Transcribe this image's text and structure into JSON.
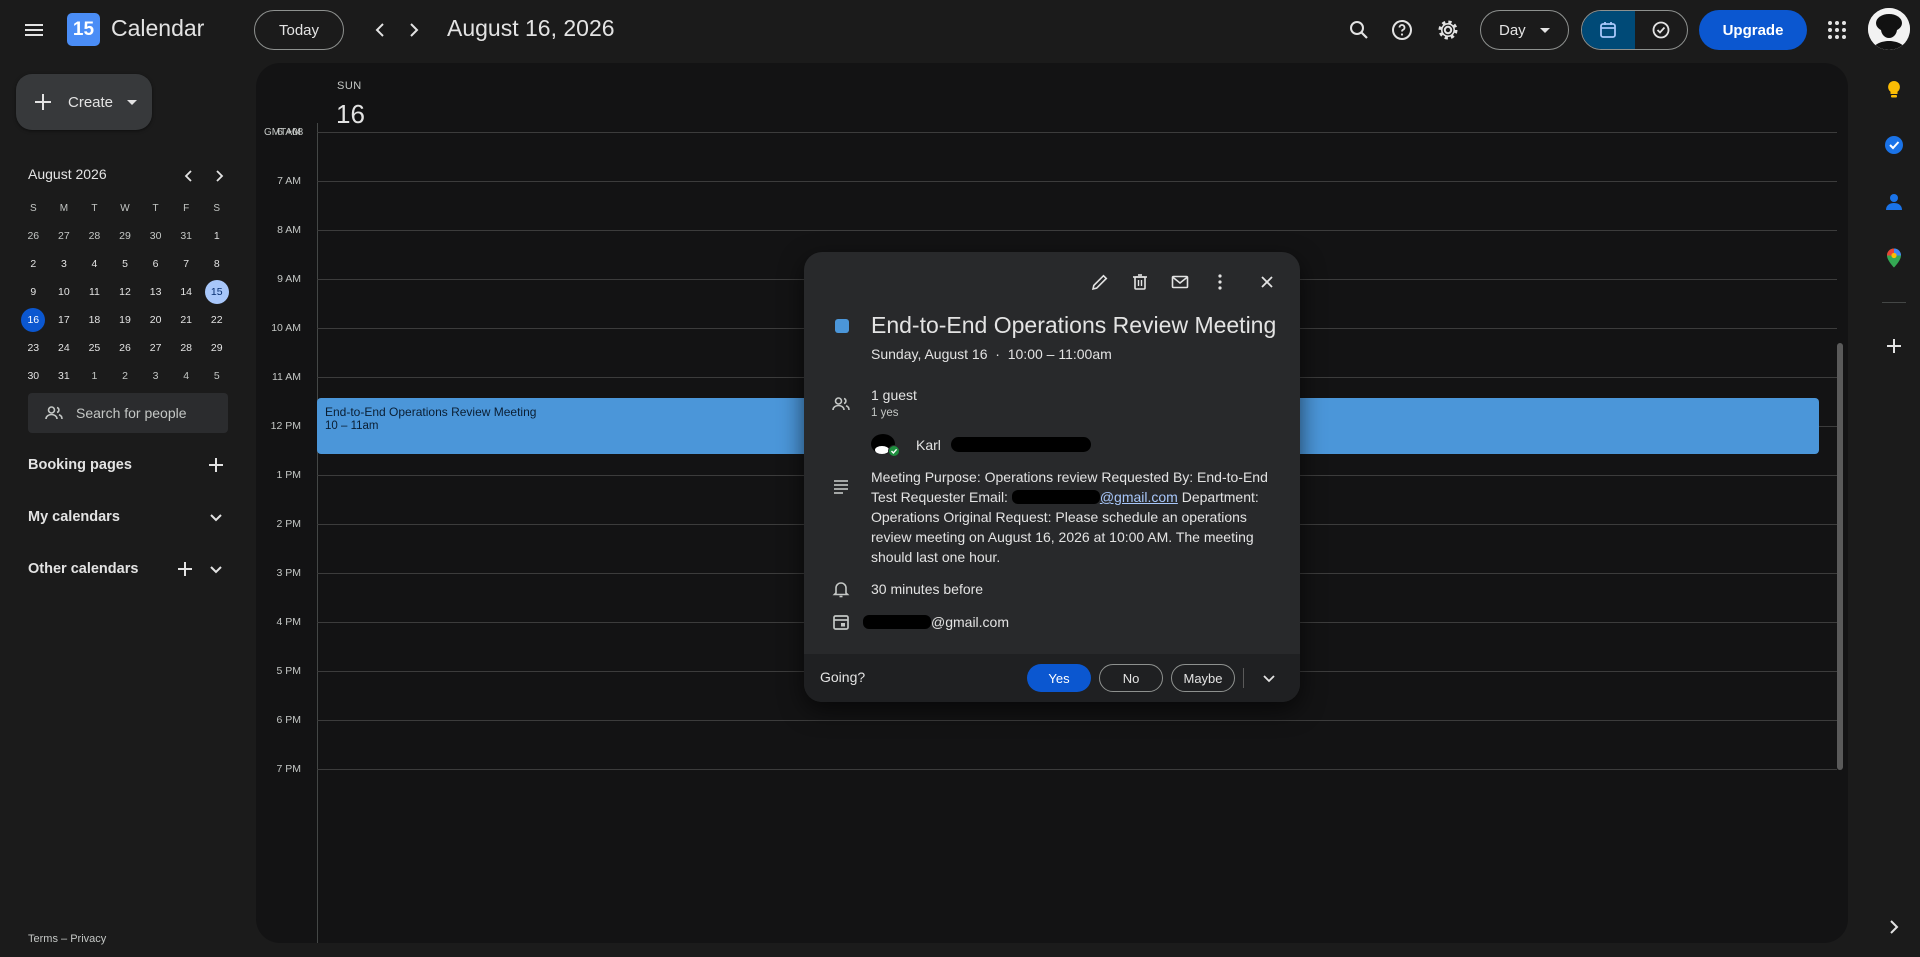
{
  "header": {
    "app_name": "Calendar",
    "logo_number": "15",
    "today_label": "Today",
    "date_title": "August 16, 2026",
    "view_label": "Day",
    "upgrade_label": "Upgrade"
  },
  "sidebar": {
    "create_label": "Create",
    "mini_calendar": {
      "title": "August 2026",
      "weekdays": [
        "S",
        "M",
        "T",
        "W",
        "T",
        "F",
        "S"
      ],
      "weeks": [
        [
          "26",
          "27",
          "28",
          "29",
          "30",
          "31",
          "1"
        ],
        [
          "2",
          "3",
          "4",
          "5",
          "6",
          "7",
          "8"
        ],
        [
          "9",
          "10",
          "11",
          "12",
          "13",
          "14",
          "15"
        ],
        [
          "16",
          "17",
          "18",
          "19",
          "20",
          "21",
          "22"
        ],
        [
          "23",
          "24",
          "25",
          "26",
          "27",
          "28",
          "29"
        ],
        [
          "30",
          "31",
          "1",
          "2",
          "3",
          "4",
          "5"
        ]
      ]
    },
    "search_people_placeholder": "Search for people",
    "booking_pages_label": "Booking pages",
    "my_calendars_label": "My calendars",
    "other_calendars_label": "Other calendars",
    "terms_label": "Terms",
    "footer_sep": "–",
    "privacy_label": "Privacy"
  },
  "day_view": {
    "day_name": "SUN",
    "day_number": "16",
    "timezone": "GMT+08",
    "hours": [
      "6 AM",
      "7 AM",
      "8 AM",
      "9 AM",
      "10 AM",
      "11 AM",
      "12 PM",
      "1 PM",
      "2 PM",
      "3 PM",
      "4 PM",
      "5 PM",
      "6 PM",
      "7 PM"
    ]
  },
  "event": {
    "title": "End-to-End Operations Review Meeting",
    "time": "10 – 11am",
    "color": "#4b96d9"
  },
  "popover": {
    "title": "End-to-End Operations Review Meeting",
    "date": "Sunday, August 16",
    "dot": "·",
    "time_range": "10:00 – 11:00am",
    "guests_count": "1 guest",
    "guests_summary": "1 yes",
    "guest_name": "Karl",
    "description_part1": "Meeting Purpose: Operations review  Requested By: End-to-End Test  Requester Email: ",
    "description_email": "@gmail.com",
    "description_part2": "  Department: Operations  Original Request: Please schedule an operations review meeting on August 16, 2026 at 10:00 AM. The meeting should last one hour.",
    "reminder": "30 minutes before",
    "calendar_owner": "@gmail.com",
    "going_label": "Going?",
    "yes_label": "Yes",
    "no_label": "No",
    "maybe_label": "Maybe"
  },
  "icons": {
    "header": [
      "menu-icon",
      "chevron-left-icon",
      "chevron-right-icon",
      "search-icon",
      "help-icon",
      "settings-icon",
      "calendar-view-icon",
      "tasks-check-icon",
      "apps-grid-icon"
    ],
    "side_panel": [
      "keep-icon",
      "tasks-icon",
      "contacts-icon",
      "maps-icon",
      "add-icon",
      "expand-panel-icon"
    ],
    "popover": [
      "edit-icon",
      "delete-icon",
      "email-icon",
      "more-options-icon",
      "close-icon",
      "people-icon",
      "description-icon",
      "bell-icon",
      "calendar-icon"
    ]
  },
  "colors": {
    "accent": "#0b57d0",
    "selected_day": "#a8c7fa",
    "event_blue": "#4b96d9"
  }
}
